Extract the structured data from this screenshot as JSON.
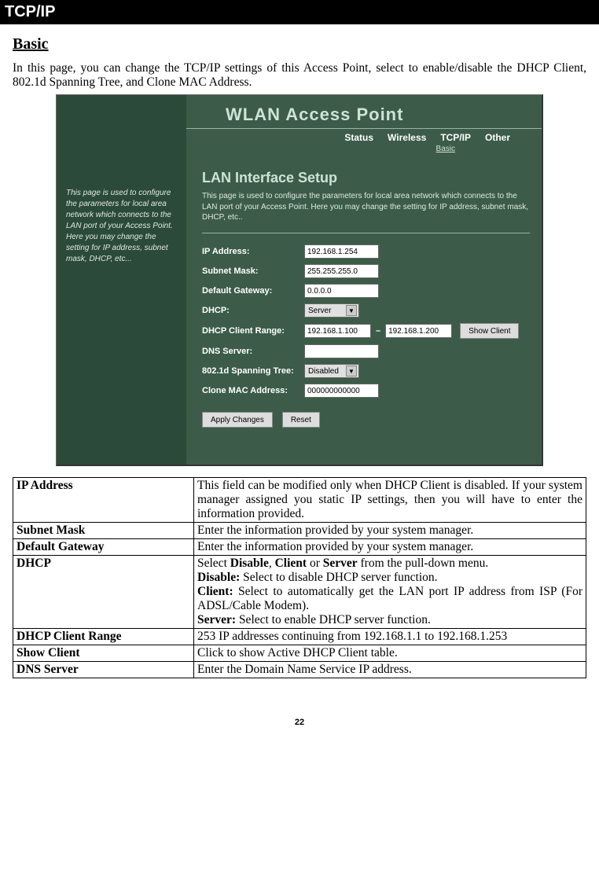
{
  "header": "TCP/IP",
  "section_title": "Basic",
  "intro": "In this page, you can change the TCP/IP settings of this Access Point, select to enable/disable the DHCP Client, 802.1d Spanning Tree, and Clone MAC Address.",
  "ap": {
    "title": "WLAN Access Point",
    "nav": {
      "status": "Status",
      "wireless": "Wireless",
      "tcpip": "TCP/IP",
      "other": "Other",
      "sub": "Basic"
    },
    "sidebar_help": "This page is used to configure the parameters for local area network which connects to the LAN port of your Access Point. Here you may change the setting for IP address, subnet mask, DHCP, etc...",
    "panel_title": "LAN Interface Setup",
    "panel_desc": "This page is used to configure the parameters for local area network which connects to the LAN port of your Access Point. Here you may change the setting for IP address, subnet mask, DHCP, etc..",
    "labels": {
      "ip": "IP Address:",
      "subnet": "Subnet Mask:",
      "gateway": "Default Gateway:",
      "dhcp": "DHCP:",
      "dhcp_range": "DHCP Client Range:",
      "dns": "DNS Server:",
      "spanning": "802.1d Spanning Tree:",
      "clone_mac": "Clone MAC Address:"
    },
    "values": {
      "ip": "192.168.1.254",
      "subnet": "255.255.255.0",
      "gateway": "0.0.0.0",
      "dhcp": "Server",
      "range_start": "192.168.1.100",
      "range_end": "192.168.1.200",
      "dns": "",
      "spanning": "Disabled",
      "clone_mac": "000000000000"
    },
    "buttons": {
      "show_client": "Show Client",
      "apply": "Apply Changes",
      "reset": "Reset"
    }
  },
  "table": {
    "rows": [
      {
        "term": "IP Address",
        "desc": "This field can be modified only when DHCP Client is disabled. If your system manager assigned you static IP settings, then you will have to enter the information provided."
      },
      {
        "term": "Subnet Mask",
        "desc": "Enter the information provided by your system manager."
      },
      {
        "term": "Default Gateway",
        "desc": "Enter the information provided by your system manager."
      }
    ],
    "dhcp": {
      "term": "DHCP",
      "line1_pre": "Select ",
      "opt_disable": "Disable",
      "sep1": ", ",
      "opt_client": "Client",
      "sep2": " or ",
      "opt_server": "Server",
      "line1_post": " from the pull-down menu.",
      "line2_b": "Disable:",
      "line2": " Select to disable DHCP server function.",
      "line3_b": "Client:",
      "line3": " Select to automatically get the LAN port IP address from ISP (For ADSL/Cable Modem).",
      "line4_b": "Server:",
      "line4": " Select to enable DHCP server function."
    },
    "rows2": [
      {
        "term": "DHCP Client Range",
        "desc": "253 IP addresses continuing from 192.168.1.1 to 192.168.1.253"
      },
      {
        "term": "Show Client",
        "desc": "Click to show Active DHCP Client table."
      },
      {
        "term": "DNS Server",
        "desc": "Enter the Domain Name Service IP address."
      }
    ]
  },
  "page_num": "22"
}
